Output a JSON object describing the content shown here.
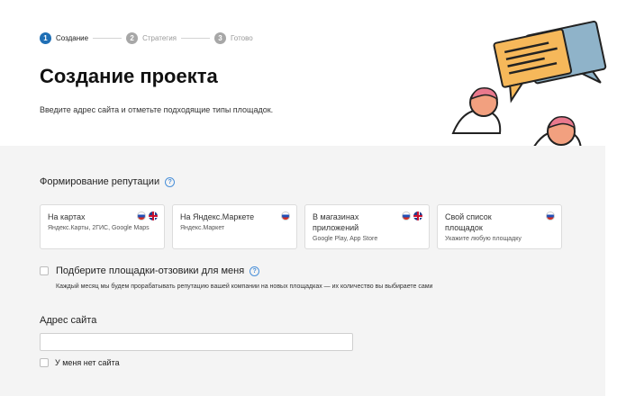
{
  "stepper": {
    "steps": [
      {
        "num": "1",
        "label": "Создание"
      },
      {
        "num": "2",
        "label": "Стратегия"
      },
      {
        "num": "3",
        "label": "Готово"
      }
    ]
  },
  "header": {
    "title": "Создание проекта",
    "subtitle": "Введите адрес сайта и отметьте подходящие типы площадок."
  },
  "reputation": {
    "title": "Формирование репутации",
    "help": "?",
    "cards": [
      {
        "title": "На картах",
        "sub": "Яндекс.Карты, 2ГИС, Google Maps"
      },
      {
        "title": "На Яндекс.Маркете",
        "sub": "Яндекс.Маркет"
      },
      {
        "title": "В магазинах приложений",
        "sub": "Google Play, App Store"
      },
      {
        "title": "Свой список площадок",
        "sub": "Укажите любую площадку"
      }
    ]
  },
  "suggest": {
    "label": "Подберите площадки-отзовики для меня",
    "help": "?",
    "note": "Каждый месяц мы будем прорабатывать репутацию вашей компании на новых площадках — их количество вы выбираете сами"
  },
  "address": {
    "label": "Адрес сайта",
    "value": "",
    "no_site_label": "У меня нет сайта"
  },
  "colors": {
    "accent": "#1f6fb5",
    "panel": "#f4f4f4"
  }
}
